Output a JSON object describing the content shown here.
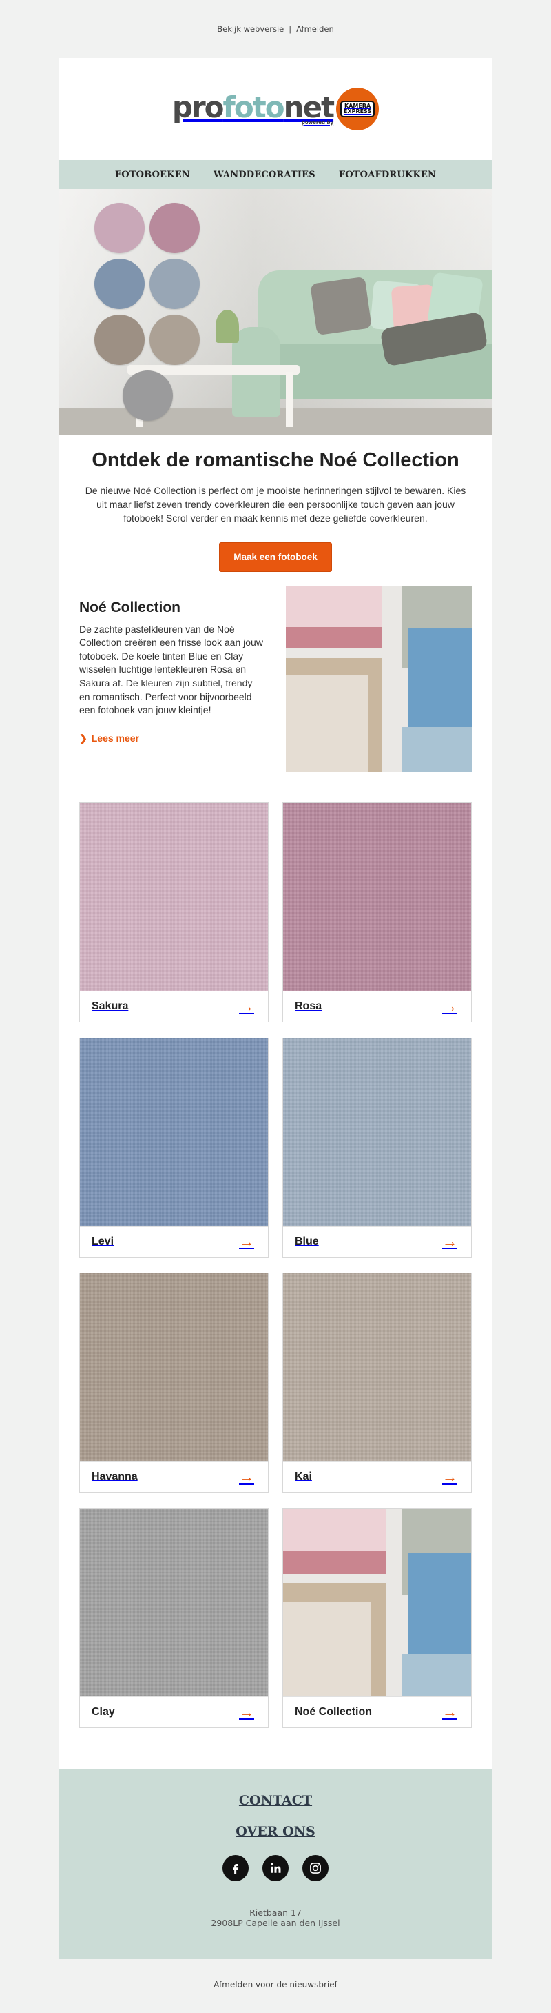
{
  "topbar": {
    "view_web": "Bekijk webversie",
    "separator": "|",
    "unsubscribe": "Afmelden"
  },
  "logo": {
    "part1": "pro",
    "part2": "foto",
    "part3": "net",
    "powered_by": "powered by",
    "partner_line1": "KAMERA",
    "partner_line2": "EXPRESS"
  },
  "nav": {
    "items": [
      "FOTOBOEKEN",
      "WANDDECORATIES",
      "FOTOAFDRUKKEN"
    ]
  },
  "hero": {
    "swatch_colors": [
      "#c9a8b8",
      "#b88a9c",
      "#7f94ad",
      "#98a6b5",
      "#9d9084",
      "#aca195",
      "#9b9b9c"
    ]
  },
  "intro": {
    "title": "Ontdek de romantische Noé Collection",
    "text": "De nieuwe Noé Collection is perfect om je mooiste herinneringen stijlvol te bewaren. Kies uit maar liefst zeven trendy coverkleuren die een persoonlijke touch geven aan jouw fotoboek! Scrol verder en maak kennis met deze geliefde coverkleuren.",
    "cta": "Maak een fotoboek"
  },
  "feature": {
    "title": "Noé Collection",
    "text": "De zachte pastelkleuren van de Noé Collection creëren een frisse look aan jouw fotoboek. De koele tinten Blue en Clay wisselen luchtige lentekleuren Rosa en Sakura af. De kleuren zijn subtiel, trendy en romantisch. Perfect voor bijvoorbeeld een fotoboek van jouw kleintje!",
    "link_icon": "❯",
    "link": "Lees meer"
  },
  "cards": [
    {
      "name": "Sakura",
      "color": "#d4b3c3",
      "arrow": "→"
    },
    {
      "name": "Rosa",
      "color": "#b8899e",
      "arrow": "→"
    },
    {
      "name": "Levi",
      "color": "#7b93b6",
      "arrow": "→"
    },
    {
      "name": "Blue",
      "color": "#9eaec0",
      "arrow": "→"
    },
    {
      "name": "Havanna",
      "color": "#aa9c8e",
      "arrow": "→"
    },
    {
      "name": "Kai",
      "color": "#b7aba0",
      "arrow": "→"
    },
    {
      "name": "Clay",
      "color": "#a2a2a2",
      "arrow": "→"
    },
    {
      "name": "Noé Collection",
      "color": "collage",
      "arrow": "→"
    }
  ],
  "footer": {
    "contact": "CONTACT",
    "about": "OVER ONS",
    "socials": [
      "facebook-icon",
      "linkedin-icon",
      "instagram-icon"
    ],
    "address_line1": "Rietbaan 17",
    "address_line2": "2908LP Capelle aan den IJssel"
  },
  "bottom": {
    "unsubscribe_newsletter": "Afmelden voor de nieuwsbrief"
  },
  "colors": {
    "accent": "#e8570f",
    "mint": "#cbdcd6",
    "background": "#f1f2f1"
  }
}
